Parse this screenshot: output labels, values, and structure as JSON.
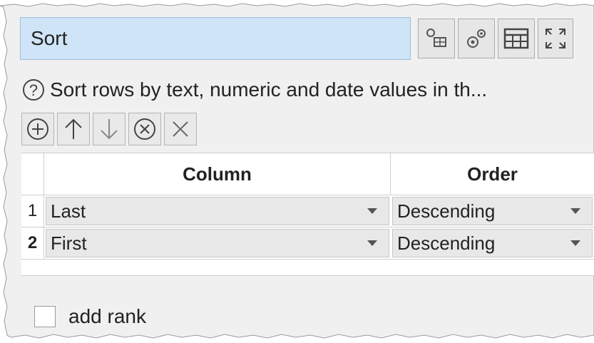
{
  "panel": {
    "title": "Sort",
    "help_text": "Sort rows by text, numeric and date values in th...",
    "toolbar_icons": [
      "connection-settings-icon",
      "gear-icon",
      "table-icon",
      "maximize-icon"
    ],
    "row_icons": [
      "add-icon",
      "up-icon",
      "down-icon",
      "remove-icon",
      "close-icon"
    ]
  },
  "grid": {
    "headers": {
      "column": "Column",
      "order": "Order"
    },
    "rows": [
      {
        "num": "1",
        "column": "Last",
        "order": "Descending"
      },
      {
        "num": "2",
        "column": "First",
        "order": "Descending"
      }
    ]
  },
  "options": {
    "add_rank_label": "add rank",
    "add_rank_checked": false
  }
}
